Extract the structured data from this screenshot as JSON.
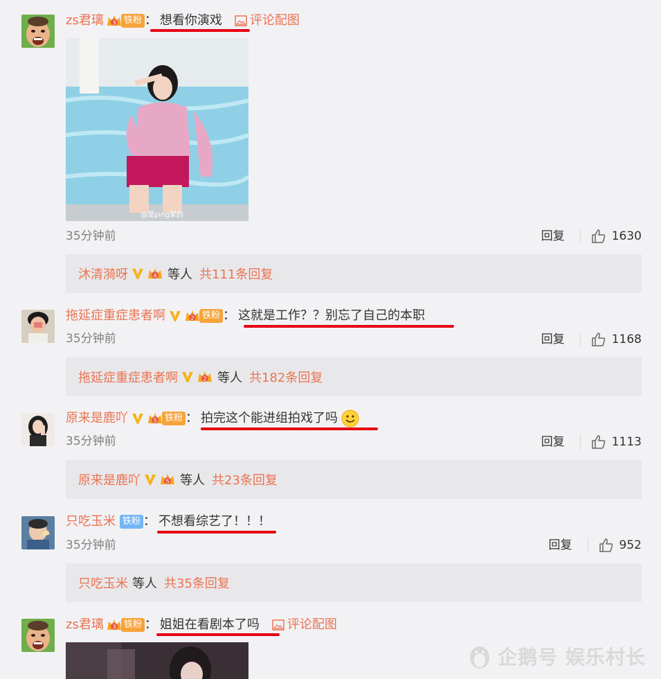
{
  "comments": [
    {
      "username": "zs君璃",
      "crown_level": "3",
      "fan_badge": "铁粉",
      "colon": "：",
      "text": "想看你演戏",
      "pic_link": "评论配图",
      "photo_watermark": "@是ping家的",
      "time": "35分钟前",
      "reply_label": "回复",
      "likes": "1630",
      "replies": {
        "name": "沐清漪呀",
        "crown_level": "4",
        "deng": "等人",
        "total": "共111条回复"
      }
    },
    {
      "username": "拖延症重症患者啊",
      "crown_level": "2",
      "fan_badge": "铁粉",
      "colon": "：",
      "text": "这就是工作？？别忘了自己的本职",
      "time": "35分钟前",
      "reply_label": "回复",
      "likes": "1168",
      "replies": {
        "name": "拖延症重症患者啊",
        "crown_level": "2",
        "deng": "等人",
        "total": "共182条回复"
      }
    },
    {
      "username": "原来是鹿吖",
      "crown_level": "5",
      "fan_badge": "铁粉",
      "colon": "：",
      "text": "拍完这个能进组拍戏了吗",
      "emoji": "smile-emoji",
      "time": "35分钟前",
      "reply_label": "回复",
      "likes": "1113",
      "replies": {
        "name": "原来是鹿吖",
        "crown_level": "5",
        "deng": "等人",
        "total": "共23条回复"
      }
    },
    {
      "username": "只吃玉米",
      "fan_badge": "铁粉",
      "colon": "：",
      "text": "不想看综艺了！！！",
      "time": "35分钟前",
      "reply_label": "回复",
      "likes": "952",
      "replies": {
        "name": "只吃玉米",
        "deng": "等人",
        "total": "共35条回复"
      }
    },
    {
      "username": "zs君璃",
      "crown_level": "3",
      "fan_badge": "铁粉",
      "colon": "：",
      "text": "姐姐在看剧本了吗",
      "pic_link": "评论配图"
    }
  ],
  "watermark": "企鹅号 娱乐村长",
  "colors": {
    "username": "#eb7350",
    "underline": "#e60012",
    "badge_gold": "#f7a33a",
    "badge_blue": "#74b5f5",
    "background": "#f2f2f5"
  }
}
